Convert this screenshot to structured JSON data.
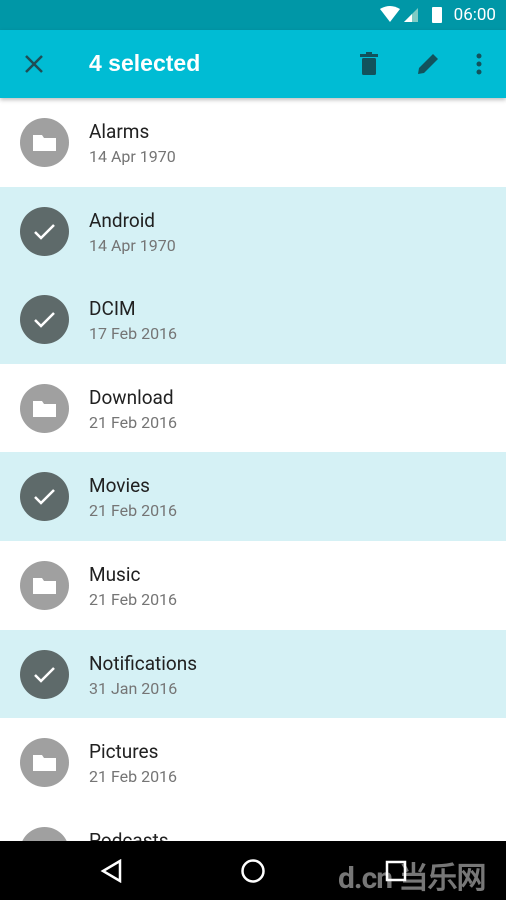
{
  "status_bar": {
    "time": "06:00"
  },
  "app_bar": {
    "title": "4 selected",
    "actions": [
      "close-icon",
      "delete-icon",
      "edit-icon",
      "more-vert-icon"
    ],
    "color": "#00bcd4"
  },
  "items": [
    {
      "name": "Alarms",
      "date": "14 Apr 1970",
      "selected": false
    },
    {
      "name": "Android",
      "date": "14 Apr 1970",
      "selected": true
    },
    {
      "name": "DCIM",
      "date": "17 Feb 2016",
      "selected": true
    },
    {
      "name": "Download",
      "date": "21 Feb 2016",
      "selected": false
    },
    {
      "name": "Movies",
      "date": "21 Feb 2016",
      "selected": true
    },
    {
      "name": "Music",
      "date": "21 Feb 2016",
      "selected": false
    },
    {
      "name": "Notifications",
      "date": "31 Jan 2016",
      "selected": true
    },
    {
      "name": "Pictures",
      "date": "21 Feb 2016",
      "selected": false
    },
    {
      "name": "Podcasts",
      "date": "",
      "selected": false
    }
  ],
  "watermark": "d.cn 当乐网"
}
